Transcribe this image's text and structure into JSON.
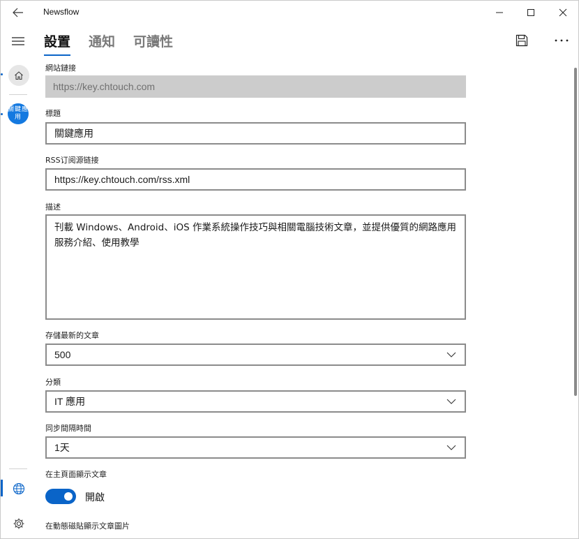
{
  "app": {
    "title": "Newsflow"
  },
  "rail": {
    "feed_avatar_text": "關鍵應用"
  },
  "tabs": [
    {
      "label": "設置",
      "active": true
    },
    {
      "label": "通知",
      "active": false
    },
    {
      "label": "可讀性",
      "active": false
    }
  ],
  "form": {
    "site_link": {
      "label": "網站鏈接",
      "value": "https://key.chtouch.com"
    },
    "title": {
      "label": "標題",
      "value": "關鍵應用"
    },
    "rss": {
      "label": "RSS订阅源链接",
      "value": "https://key.chtouch.com/rss.xml"
    },
    "description": {
      "label": "描述",
      "value": "刊載 Windows、Android、iOS 作業系統操作技巧與相關電腦技術文章，並提供優質的網路應用服務介紹、使用教學"
    },
    "store_latest": {
      "label": "存儲最新的文章",
      "value": "500"
    },
    "category": {
      "label": "分類",
      "value": "IT 應用"
    },
    "sync_interval": {
      "label": "同步間隔時間",
      "value": "1天"
    },
    "show_on_home": {
      "label": "在主頁面顯示文章",
      "toggle_text": "開啟",
      "on": true
    },
    "live_tile": {
      "label": "在動態磁貼顯示文章圖片"
    }
  },
  "colors": {
    "accent": "#0a64c8",
    "readonly_bg": "#cccccc",
    "border": "#8b8b8b"
  }
}
